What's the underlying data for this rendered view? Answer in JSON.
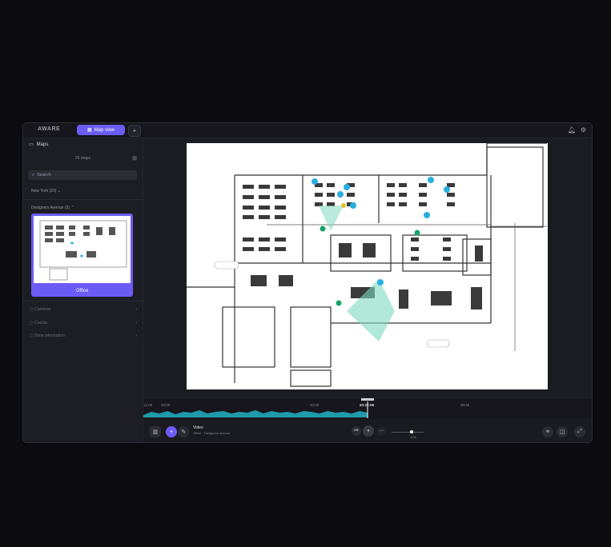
{
  "app": {
    "brand": "AWARE"
  },
  "topbar": {
    "map_tab_label": "Map view",
    "add_tab": "+"
  },
  "sidebar": {
    "title": "Maps",
    "map_count": "20 maps",
    "search_placeholder": "Search",
    "location": "New York (20)",
    "zone": "Designers Avenue (3)",
    "card_label": "Office",
    "sections": [
      "Cameras",
      "Counts",
      "Zone information"
    ]
  },
  "timeline": {
    "start_label": "12:00",
    "ticks": [
      "20:00",
      "20:20",
      "20:40"
    ],
    "current": "20:22:06"
  },
  "controls": {
    "camera_title": "Video",
    "camera_subtitle": "Office · Designers Avenue",
    "speed": "1.0x"
  },
  "colors": {
    "accent": "#6b5cf6",
    "camera_blue": "#29aee0",
    "sensor_green": "#1aa36a",
    "fov": "#7fd8c0"
  },
  "icons": [
    "map-icon",
    "bell-icon",
    "settings-icon",
    "grid-icon",
    "search-icon",
    "camera-icon",
    "layout-icon",
    "pencil-icon",
    "fullscreen-icon"
  ]
}
